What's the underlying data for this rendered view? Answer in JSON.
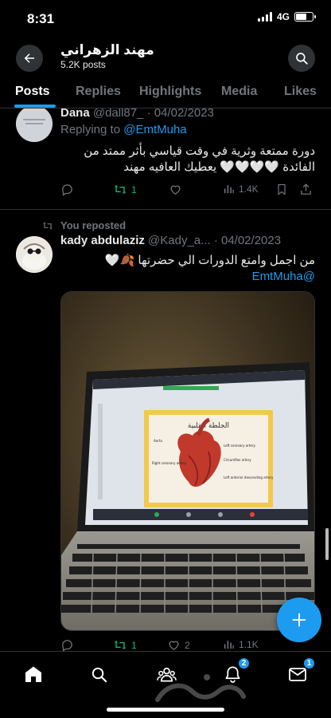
{
  "status": {
    "time": "8:31",
    "network": "4G",
    "battery_level": 0.65
  },
  "header": {
    "title": "مهند الزهراني",
    "subtitle": "5.2K posts"
  },
  "tabs": [
    {
      "label": "Posts",
      "active": true
    },
    {
      "label": "Replies",
      "active": false
    },
    {
      "label": "Highlights",
      "active": false
    },
    {
      "label": "Media",
      "active": false
    },
    {
      "label": "Likes",
      "active": false
    }
  ],
  "post1": {
    "name": "Dana",
    "handle": "@dall87_",
    "date": "· 04/02/2023",
    "replying_prefix": "Replying to ",
    "replying_handle": "@EmtMuha",
    "line1": "دورة ممتعة وثرية في وقت قياسي بأثر ممتد من",
    "line2": "الفائدة 🤍🤍🤍🤍 يعطيك العافيه مهند",
    "reposts": "1",
    "views": "1.4K"
  },
  "post2": {
    "repost_label": "You reposted",
    "name": "kady abdulaziz",
    "handle": "@Kady_a...",
    "date": "· 04/02/2023",
    "text": "من اجمل وامتع الدورات الي حضرتها 🍂🤍",
    "mention": "@EmtMuha",
    "reposts": "1",
    "likes": "2",
    "views": "1.1K",
    "slide_title": "الجلطة القلبية",
    "slide_label_right_coronary": "Right coronary artery",
    "slide_label_left_coronary": "Left coronary artery",
    "slide_label_circumflex": "Circumflex artery",
    "slide_label_lad": "Left anterior descending artery",
    "slide_label_aorta": "Aorta"
  },
  "nav": {
    "notifications_badge": "2",
    "messages_badge": "1"
  },
  "colors": {
    "accent": "#1d9bf0",
    "repost": "#00ba7c",
    "muted": "#71767b",
    "background": "#000000"
  },
  "icons": [
    "back-arrow-icon",
    "search-icon",
    "reply-icon",
    "repost-icon",
    "like-icon",
    "views-icon",
    "bookmark-icon",
    "share-icon",
    "home-icon",
    "communities-icon",
    "notifications-icon",
    "messages-icon",
    "compose-plus-icon"
  ]
}
